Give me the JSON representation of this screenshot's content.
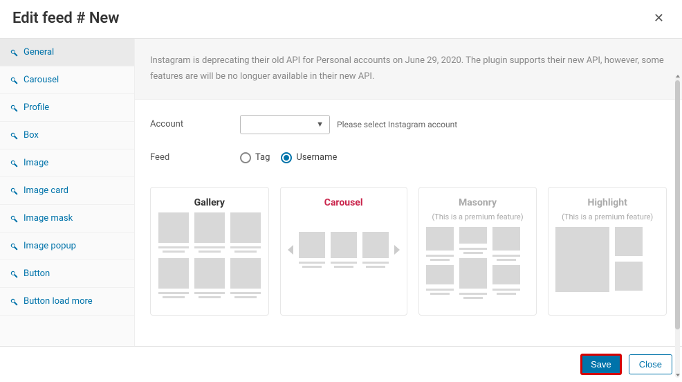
{
  "header": {
    "title": "Edit feed # New"
  },
  "sidebar": {
    "items": [
      {
        "label": "General"
      },
      {
        "label": "Carousel"
      },
      {
        "label": "Profile"
      },
      {
        "label": "Box"
      },
      {
        "label": "Image"
      },
      {
        "label": "Image card"
      },
      {
        "label": "Image mask"
      },
      {
        "label": "Image popup"
      },
      {
        "label": "Button"
      },
      {
        "label": "Button load more"
      }
    ]
  },
  "notice": "Instagram is deprecating their old API for Personal accounts on June 29, 2020. The plugin supports their new API, however, some features are will be no longuer available in their new API.",
  "form": {
    "account_label": "Account",
    "account_hint": "Please select Instagram account",
    "feed_label": "Feed",
    "feed_options": {
      "tag": "Tag",
      "username": "Username"
    }
  },
  "layouts": {
    "gallery": {
      "title": "Gallery"
    },
    "carousel": {
      "title": "Carousel"
    },
    "masonry": {
      "title": "Masonry",
      "sub": "(This is a premium feature)"
    },
    "highlight": {
      "title": "Highlight",
      "sub": "(This is a premium feature)"
    }
  },
  "footer": {
    "save": "Save",
    "close": "Close"
  }
}
